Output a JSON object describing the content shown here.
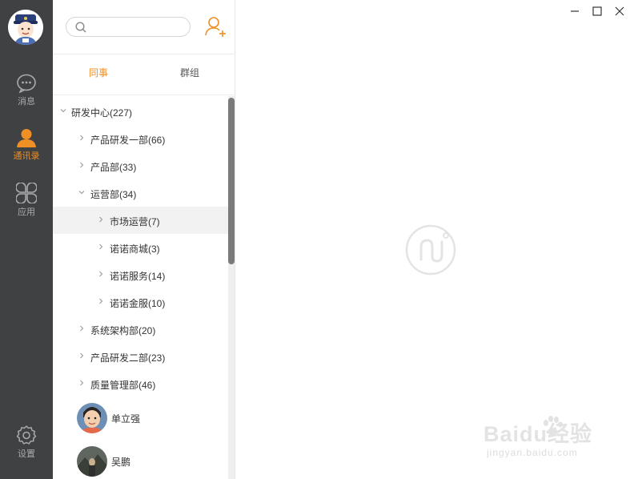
{
  "rail": {
    "items": [
      {
        "label": "消息",
        "icon": "chat-bubble-icon",
        "active": false
      },
      {
        "label": "通讯录",
        "icon": "contact-person-icon",
        "active": true
      },
      {
        "label": "应用",
        "icon": "apps-clover-icon",
        "active": false
      }
    ],
    "settings_label": "设置"
  },
  "search": {
    "placeholder": ""
  },
  "tabs": [
    {
      "label": "同事",
      "active": true
    },
    {
      "label": "群组",
      "active": false
    }
  ],
  "tree": [
    {
      "label": "研发中心(227)",
      "level": 0,
      "expanded": true
    },
    {
      "label": "产品研发一部(66)",
      "level": 1,
      "expanded": false
    },
    {
      "label": "产品部(33)",
      "level": 1,
      "expanded": false
    },
    {
      "label": "运营部(34)",
      "level": 1,
      "expanded": true
    },
    {
      "label": "市场运营(7)",
      "level": 2,
      "expanded": false,
      "selected": true
    },
    {
      "label": "诺诺商城(3)",
      "level": 2,
      "expanded": false
    },
    {
      "label": "诺诺服务(14)",
      "level": 2,
      "expanded": false
    },
    {
      "label": "诺诺金服(10)",
      "level": 2,
      "expanded": false
    },
    {
      "label": "系统架构部(20)",
      "level": 1,
      "expanded": false
    },
    {
      "label": "产品研发二部(23)",
      "level": 1,
      "expanded": false
    },
    {
      "label": "质量管理部(46)",
      "level": 1,
      "expanded": false
    }
  ],
  "people": [
    {
      "name": "单立强"
    },
    {
      "name": "吴鹏"
    }
  ],
  "watermark": {
    "brand": "Baidu经验",
    "site": "jingyan.baidu.com"
  },
  "colors": {
    "accent": "#f08f23",
    "rail": "#3f4142"
  }
}
